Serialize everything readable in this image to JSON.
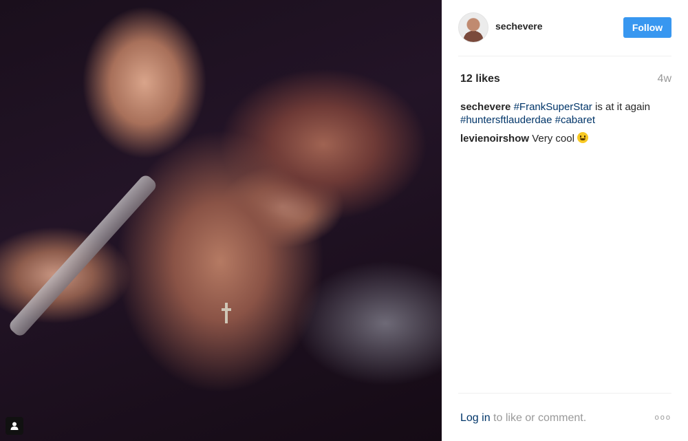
{
  "post": {
    "username": "sechevere",
    "follow_label": "Follow",
    "likes": "12 likes",
    "age": "4w",
    "caption": {
      "author": "sechevere",
      "tag1": "#FrankSuperStar",
      "text_mid": " is at it again ",
      "tag2": "#huntersftlauderdae",
      "tag3": "#cabaret"
    },
    "comments": [
      {
        "author": "levienoirshow",
        "text": "Very cool"
      }
    ],
    "footer": {
      "login_label": "Log in",
      "rest": " to like or comment.",
      "more": "ooo"
    }
  },
  "colors": {
    "accent": "#3897f0",
    "link": "#003569",
    "muted": "#999999"
  }
}
